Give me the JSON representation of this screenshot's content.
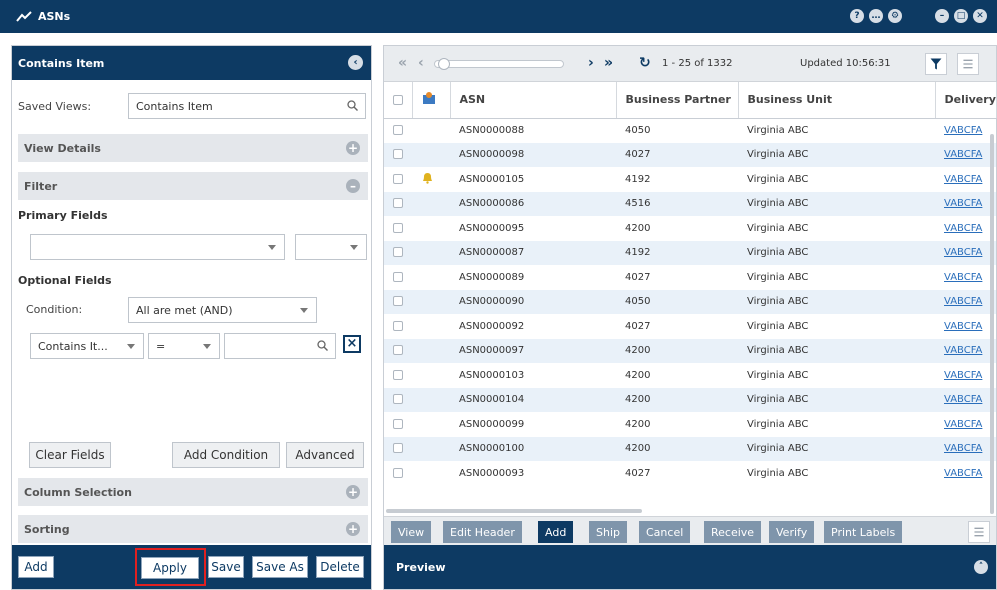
{
  "window": {
    "title": "ASNs",
    "controls_right_a": [
      "?",
      "…",
      "⚙"
    ],
    "controls_right_b": [
      "–",
      "□",
      "✕"
    ]
  },
  "left_panel": {
    "header": "Contains Item",
    "saved_views_label": "Saved Views:",
    "saved_views_value": "Contains Item",
    "view_details": "View Details",
    "filter": "Filter",
    "primary_fields": "Primary Fields",
    "optional_fields": "Optional Fields",
    "condition_label": "Condition:",
    "condition_value": "All are met (AND)",
    "field_select": "Contains It...",
    "operator_select": "=",
    "clear_fields": "Clear Fields",
    "add_condition": "Add Condition",
    "advanced": "Advanced",
    "column_selection": "Column Selection",
    "sorting": "Sorting",
    "footer": {
      "add": "Add",
      "apply": "Apply",
      "save": "Save",
      "save_as": "Save As",
      "delete": "Delete"
    }
  },
  "grid": {
    "paging_text": "1 - 25 of 1332",
    "updated_text": "Updated 10:56:31",
    "columns": [
      "ASN",
      "Business Partner",
      "Business Unit",
      "Delivery"
    ],
    "rows": [
      {
        "asn": "ASN0000088",
        "partner": "4050",
        "unit": "Virginia ABC",
        "delivery": "VABCFA",
        "alert": false
      },
      {
        "asn": "ASN0000098",
        "partner": "4027",
        "unit": "Virginia ABC",
        "delivery": "VABCFA",
        "alert": false
      },
      {
        "asn": "ASN0000105",
        "partner": "4192",
        "unit": "Virginia ABC",
        "delivery": "VABCFA",
        "alert": true
      },
      {
        "asn": "ASN0000086",
        "partner": "4516",
        "unit": "Virginia ABC",
        "delivery": "VABCFA",
        "alert": false
      },
      {
        "asn": "ASN0000095",
        "partner": "4200",
        "unit": "Virginia ABC",
        "delivery": "VABCFA",
        "alert": false
      },
      {
        "asn": "ASN0000087",
        "partner": "4192",
        "unit": "Virginia ABC",
        "delivery": "VABCFA",
        "alert": false
      },
      {
        "asn": "ASN0000089",
        "partner": "4027",
        "unit": "Virginia ABC",
        "delivery": "VABCFA",
        "alert": false
      },
      {
        "asn": "ASN0000090",
        "partner": "4050",
        "unit": "Virginia ABC",
        "delivery": "VABCFA",
        "alert": false
      },
      {
        "asn": "ASN0000092",
        "partner": "4027",
        "unit": "Virginia ABC",
        "delivery": "VABCFA",
        "alert": false
      },
      {
        "asn": "ASN0000097",
        "partner": "4200",
        "unit": "Virginia ABC",
        "delivery": "VABCFA",
        "alert": false
      },
      {
        "asn": "ASN0000103",
        "partner": "4200",
        "unit": "Virginia ABC",
        "delivery": "VABCFA",
        "alert": false
      },
      {
        "asn": "ASN0000104",
        "partner": "4200",
        "unit": "Virginia ABC",
        "delivery": "VABCFA",
        "alert": false
      },
      {
        "asn": "ASN0000099",
        "partner": "4200",
        "unit": "Virginia ABC",
        "delivery": "VABCFA",
        "alert": false
      },
      {
        "asn": "ASN0000100",
        "partner": "4200",
        "unit": "Virginia ABC",
        "delivery": "VABCFA",
        "alert": false
      },
      {
        "asn": "ASN0000093",
        "partner": "4027",
        "unit": "Virginia ABC",
        "delivery": "VABCFA",
        "alert": false
      }
    ],
    "actions": [
      "View",
      "Edit Header",
      "Add",
      "Ship",
      "Cancel",
      "Receive",
      "Verify",
      "Print Labels"
    ],
    "preview_label": "Preview"
  },
  "colors": {
    "brand": "#0d3a63",
    "row_alt": "#e9f1f9",
    "action_btn": "#7f95ab",
    "highlight": "#e02020"
  }
}
